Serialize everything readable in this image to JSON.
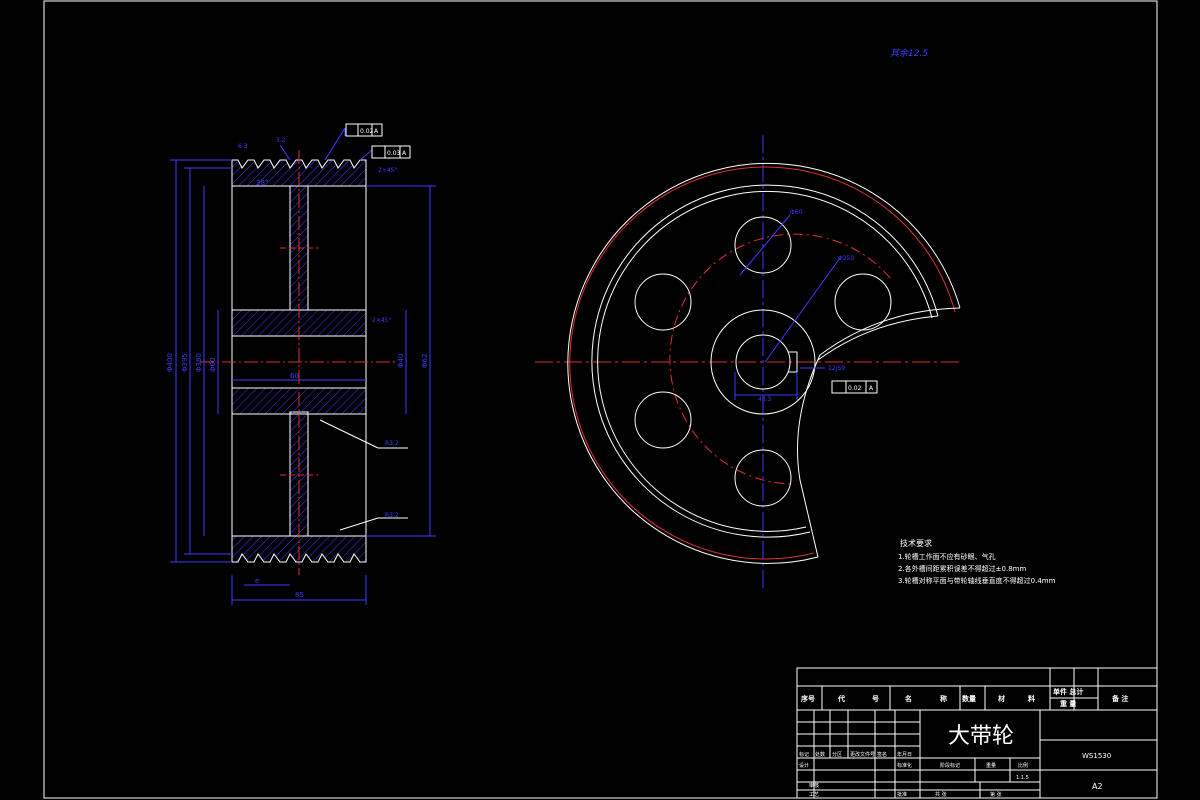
{
  "drawing": {
    "part_name": "大带轮",
    "drawing_no": "WS1530",
    "sheet_size": "A2",
    "scale": "1:1.5",
    "top_note": "其余12.5"
  },
  "technical_requirements": {
    "title": "技术要求",
    "items": [
      "1.轮槽工作面不应有砂眼、气孔",
      "2.各外槽间距累积误差不得超过±0.8mm",
      "3.轮槽对称平面与带轮轴线垂直度不得超过0.4mm"
    ]
  },
  "title_block": {
    "headers": [
      "序号",
      "代",
      "号",
      "名",
      "称",
      "数量",
      "材",
      "料"
    ],
    "weight_header_1": "单件 总计",
    "weight_header_2": "重 量",
    "remark_header": "备 注",
    "rev_labels": [
      "标记",
      "处数",
      "分区",
      "更改文件号",
      "签名",
      "年月日"
    ],
    "design_label": "设计",
    "standard_label": "标准化",
    "stage_label": "阶段标记",
    "weight_label": "重量",
    "scale_label": "比例",
    "check_label": "审核",
    "process_label": "工艺",
    "approve_label": "批准",
    "sheet_total": "共 张",
    "sheet_no": "第 张"
  },
  "side_view": {
    "dims": {
      "d_outer": "Φ400",
      "d_pitch": "Φ395",
      "d_root": "Φ380",
      "d_hub": "Φ60",
      "d_bore": "Φ40",
      "width": "85",
      "hub_len": "60",
      "groove_angle": "38°",
      "groove_pitch": "e",
      "chamfer1": "2×45°",
      "chamfer2": "2×45°",
      "fillet1": "R3.2",
      "fillet2": "R3.2",
      "right_dia": "Φ62",
      "roughness_a": "3.2",
      "roughness_b": "6.3",
      "tol_frame_1": "0.02",
      "tol_frame_2": "0.03",
      "tol_frame_3": "A",
      "tol_frame_4": "A"
    }
  },
  "front_view": {
    "dims": {
      "hole_dia": "Φ60",
      "pcd": "Φ250",
      "keyway": "43.3",
      "keyway_w": "12JS9",
      "tol_label": "0.02",
      "tol_ref": "A"
    }
  }
}
